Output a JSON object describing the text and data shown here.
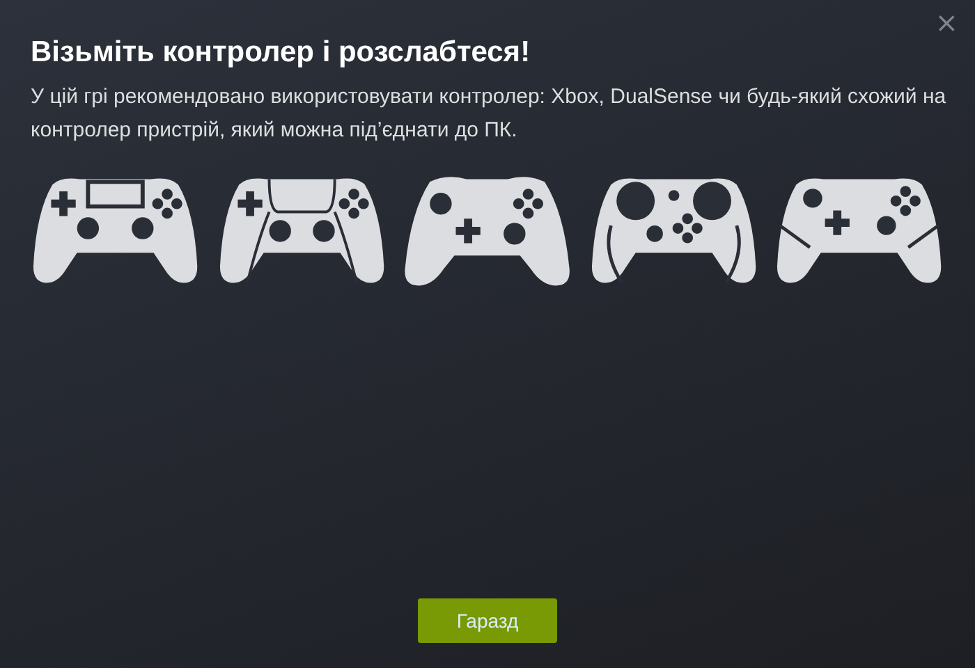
{
  "dialog": {
    "close": "×",
    "title": "Візьміть контролер і розслабтеся!",
    "description": "У цій грі рекомендовано використовувати контролер: Xbox, DualSense чи будь-який схожий на контролер пристрій, який можна під’єднати до ПК."
  },
  "controllers": [
    {
      "kind": "ps4"
    },
    {
      "kind": "dualsense"
    },
    {
      "kind": "xbox"
    },
    {
      "kind": "steam"
    },
    {
      "kind": "switch"
    }
  ],
  "buttons": [
    {
      "label": "Гаразд"
    }
  ]
}
